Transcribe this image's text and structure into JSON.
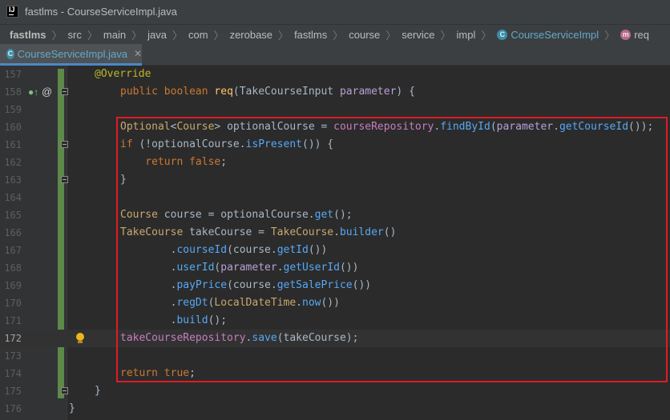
{
  "window": {
    "title": "fastlms - CourseServiceImpl.java"
  },
  "breadcrumb": {
    "items": [
      "fastlms",
      "src",
      "main",
      "java",
      "com",
      "zerobase",
      "fastlms",
      "course",
      "service",
      "impl"
    ],
    "class_name": "CourseServiceImpl",
    "method_name": "req"
  },
  "tab": {
    "label": "CourseServiceImpl.java",
    "close": "✕"
  },
  "gutter_icons": {
    "override": "●↑",
    "annotation": "@"
  },
  "lines": [
    {
      "num": "157",
      "tokens": [
        {
          "t": "@Override",
          "c": "ann"
        }
      ]
    },
    {
      "num": "158",
      "tokens": [
        {
          "t": "public ",
          "c": "k"
        },
        {
          "t": "boolean ",
          "c": "k"
        },
        {
          "t": "req",
          "c": "fn"
        },
        {
          "t": "(",
          "c": "pl"
        },
        {
          "t": "TakeCourseInput ",
          "c": "pl"
        },
        {
          "t": "parameter",
          "c": "pm"
        },
        {
          "t": ") {",
          "c": "pl"
        }
      ]
    },
    {
      "num": "159",
      "tokens": []
    },
    {
      "num": "160",
      "tokens": [
        {
          "t": "Optional",
          "c": "ty"
        },
        {
          "t": "<",
          "c": "pl"
        },
        {
          "t": "Course",
          "c": "ty"
        },
        {
          "t": "> optionalCourse = ",
          "c": "pl"
        },
        {
          "t": "courseRepository",
          "c": "fld"
        },
        {
          "t": ".",
          "c": "pl"
        },
        {
          "t": "findById",
          "c": "call"
        },
        {
          "t": "(",
          "c": "pl"
        },
        {
          "t": "parameter",
          "c": "pm"
        },
        {
          "t": ".",
          "c": "pl"
        },
        {
          "t": "getCourseId",
          "c": "call"
        },
        {
          "t": "());",
          "c": "pl"
        }
      ]
    },
    {
      "num": "161",
      "tokens": [
        {
          "t": "if ",
          "c": "k"
        },
        {
          "t": "(!optionalCourse.",
          "c": "pl"
        },
        {
          "t": "isPresent",
          "c": "call"
        },
        {
          "t": "()) {",
          "c": "pl"
        }
      ]
    },
    {
      "num": "162",
      "tokens": [
        {
          "t": "    return ",
          "c": "k"
        },
        {
          "t": "false",
          "c": "k"
        },
        {
          "t": ";",
          "c": "pl"
        }
      ]
    },
    {
      "num": "163",
      "tokens": [
        {
          "t": "}",
          "c": "pl"
        }
      ]
    },
    {
      "num": "164",
      "tokens": []
    },
    {
      "num": "165",
      "tokens": [
        {
          "t": "Course ",
          "c": "ty"
        },
        {
          "t": "course = optionalCourse.",
          "c": "pl"
        },
        {
          "t": "get",
          "c": "call"
        },
        {
          "t": "();",
          "c": "pl"
        }
      ]
    },
    {
      "num": "166",
      "tokens": [
        {
          "t": "TakeCourse ",
          "c": "ty"
        },
        {
          "t": "takeCourse = ",
          "c": "pl"
        },
        {
          "t": "TakeCourse",
          "c": "ty"
        },
        {
          "t": ".",
          "c": "pl"
        },
        {
          "t": "builder",
          "c": "call"
        },
        {
          "t": "()",
          "c": "pl"
        }
      ]
    },
    {
      "num": "167",
      "tokens": [
        {
          "t": "        .",
          "c": "pl"
        },
        {
          "t": "courseId",
          "c": "call"
        },
        {
          "t": "(course.",
          "c": "pl"
        },
        {
          "t": "getId",
          "c": "call"
        },
        {
          "t": "())",
          "c": "pl"
        }
      ]
    },
    {
      "num": "168",
      "tokens": [
        {
          "t": "        .",
          "c": "pl"
        },
        {
          "t": "userId",
          "c": "call"
        },
        {
          "t": "(",
          "c": "pl"
        },
        {
          "t": "parameter",
          "c": "pm"
        },
        {
          "t": ".",
          "c": "pl"
        },
        {
          "t": "getUserId",
          "c": "call"
        },
        {
          "t": "())",
          "c": "pl"
        }
      ]
    },
    {
      "num": "169",
      "tokens": [
        {
          "t": "        .",
          "c": "pl"
        },
        {
          "t": "payPrice",
          "c": "call"
        },
        {
          "t": "(course.",
          "c": "pl"
        },
        {
          "t": "getSalePrice",
          "c": "call"
        },
        {
          "t": "())",
          "c": "pl"
        }
      ]
    },
    {
      "num": "170",
      "tokens": [
        {
          "t": "        .",
          "c": "pl"
        },
        {
          "t": "regDt",
          "c": "call"
        },
        {
          "t": "(",
          "c": "pl"
        },
        {
          "t": "LocalDateTime",
          "c": "ty"
        },
        {
          "t": ".",
          "c": "pl"
        },
        {
          "t": "now",
          "c": "call"
        },
        {
          "t": "())",
          "c": "pl"
        }
      ]
    },
    {
      "num": "171",
      "tokens": [
        {
          "t": "        .",
          "c": "pl"
        },
        {
          "t": "build",
          "c": "call"
        },
        {
          "t": "();",
          "c": "pl"
        }
      ]
    },
    {
      "num": "172",
      "tokens": [
        {
          "t": "takeCourseRepository",
          "c": "fld"
        },
        {
          "t": ".",
          "c": "pl"
        },
        {
          "t": "save",
          "c": "call"
        },
        {
          "t": "(takeCourse);",
          "c": "pl"
        }
      ]
    },
    {
      "num": "173",
      "tokens": []
    },
    {
      "num": "174",
      "tokens": [
        {
          "t": "return ",
          "c": "k"
        },
        {
          "t": "true",
          "c": "k"
        },
        {
          "t": ";",
          "c": "pl"
        }
      ]
    },
    {
      "num": "175",
      "tokens": [
        {
          "t": "}",
          "c": "pl"
        }
      ]
    },
    {
      "num": "176",
      "tokens": [
        {
          "t": "}",
          "c": "pl"
        }
      ]
    }
  ],
  "colors": {
    "background": "#2b2b2b",
    "keyword": "#cc7832",
    "annotation": "#bbb529",
    "method_call": "#56a8f5",
    "field": "#c77dbb",
    "highlight_box": "#e01b24",
    "change_marker": "#5e8a49"
  }
}
